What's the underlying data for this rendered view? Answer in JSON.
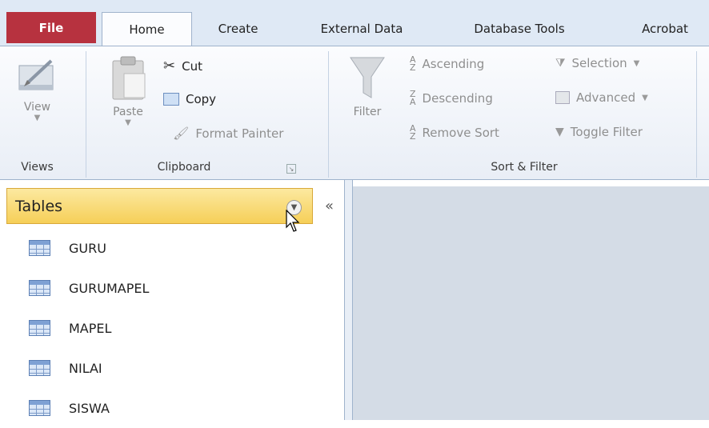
{
  "tabs": {
    "file": "File",
    "home": "Home",
    "create": "Create",
    "external_data": "External Data",
    "database_tools": "Database Tools",
    "acrobat": "Acrobat"
  },
  "ribbon": {
    "views": {
      "view_label": "View",
      "group": "Views"
    },
    "clipboard": {
      "paste_label": "Paste",
      "cut": "Cut",
      "copy": "Copy",
      "format_painter": "Format Painter",
      "group": "Clipboard"
    },
    "sort_filter": {
      "filter_label": "Filter",
      "ascending": "Ascending",
      "descending": "Descending",
      "remove_sort": "Remove Sort",
      "selection": "Selection",
      "advanced": "Advanced",
      "toggle_filter": "Toggle Filter",
      "group": "Sort & Filter"
    }
  },
  "nav": {
    "header": "Tables",
    "collapse": "«",
    "items": [
      "GURU",
      "GURUMAPEL",
      "MAPEL",
      "NILAI",
      "SISWA"
    ]
  },
  "colors": {
    "file_tab": "#b7323f",
    "nav_header": "#f6cf58",
    "workspace": "#d4dce6"
  }
}
